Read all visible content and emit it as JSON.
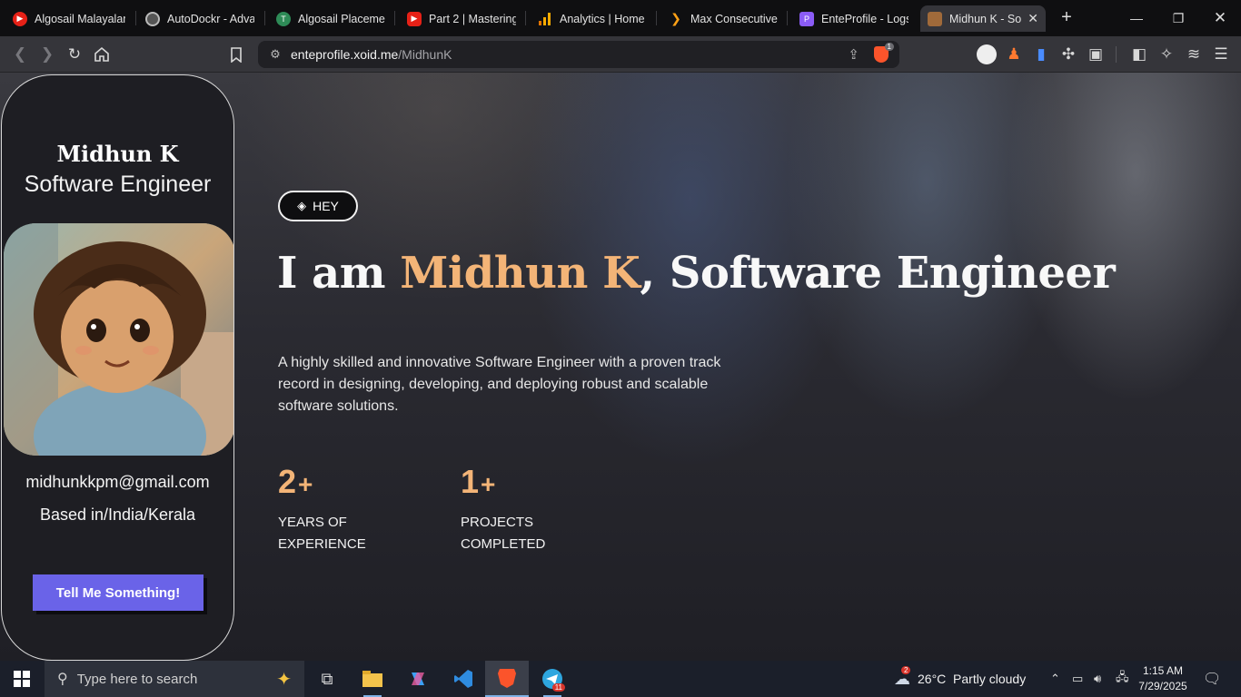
{
  "browser": {
    "tabs": [
      {
        "title": "Algosail Malayalam",
        "favicon": "youtube-icon",
        "color": "#e62117"
      },
      {
        "title": "AutoDockr - Adva",
        "favicon": "globe-icon",
        "color": "#666666"
      },
      {
        "title": "Algosail Placemen",
        "favicon": "algosail-icon",
        "color": "#2e8b57"
      },
      {
        "title": "Part 2 | Mastering",
        "favicon": "youtube-icon",
        "color": "#e62117"
      },
      {
        "title": "Analytics | Home",
        "favicon": "analytics-icon",
        "color": "#f9ab00"
      },
      {
        "title": "Max Consecutive",
        "favicon": "leetcode-icon",
        "color": "#ffa116"
      },
      {
        "title": "EnteProfile - Logs",
        "favicon": "enteprofile-icon",
        "color": "#8b5cf6"
      },
      {
        "title": "Midhun K - So",
        "favicon": "avatar-icon",
        "color": "#a06a3a"
      }
    ],
    "url_host": "enteprofile.xoid.me",
    "url_path": "/MidhunK",
    "shield_count": "1"
  },
  "profile": {
    "name": "Midhun K",
    "role": "Software Engineer",
    "email": "midhunkkpm@gmail.com",
    "location": "Based in/India/Kerala",
    "cta_label": "Tell Me Something!"
  },
  "hero": {
    "badge": "HEY",
    "headline_prefix": "I am ",
    "headline_name": "Midhun K",
    "headline_suffix": ", Software Engineer",
    "bio": "A highly skilled and innovative Software Engineer with a proven track record in designing, developing, and deploying robust and scalable software solutions.",
    "stats": [
      {
        "number": "2",
        "suffix": "+",
        "label_line1": "Years of",
        "label_line2": "Experience"
      },
      {
        "number": "1",
        "suffix": "+",
        "label_line1": "Projects",
        "label_line2": "Completed"
      }
    ],
    "accent_color": "#f3b477",
    "cta_color": "#6a63e8"
  },
  "taskbar": {
    "search_placeholder": "Type here to search",
    "weather": "26°C  Partly cloudy",
    "weather_badge": "2",
    "time": "1:15 AM",
    "date": "7/29/2025",
    "telegram_badge": "11"
  }
}
